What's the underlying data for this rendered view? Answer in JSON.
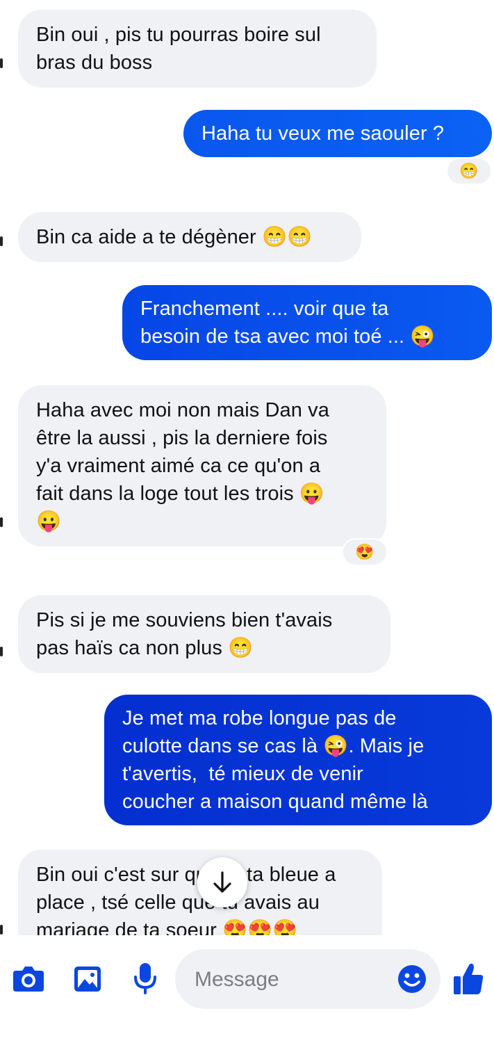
{
  "conversation": {
    "messages": [
      {
        "direction": "incoming",
        "text": "Bin oui , pis tu pourras boire sul\nbras du boss"
      },
      {
        "direction": "outgoing",
        "text": "Haha tu veux me saouler ?",
        "reaction": "😁"
      },
      {
        "direction": "incoming",
        "text": "Bin ca aide a te dégèner 😁😁"
      },
      {
        "direction": "outgoing",
        "text": "Franchement .... voir que ta\nbesoin de tsa avec moi toé ... 😜"
      },
      {
        "direction": "incoming",
        "text": "Haha avec moi non mais Dan va\nêtre la aussi , pis la derniere fois\ny'a vraiment aimé ca ce qu'on a\nfait dans la loge tout les trois 😛\n😛",
        "reaction": "😍"
      },
      {
        "direction": "incoming",
        "text": "Pis si je me souviens bien t'avais\npas haïs ca non plus 😁"
      },
      {
        "direction": "outgoing",
        "text": "Je met ma robe longue pas de\nculotte dans se cas là 😜. Mais je\nt'avertis,  té mieux de venir\ncoucher a maison quand même là"
      },
      {
        "direction": "incoming",
        "text": "Bin oui c'est sur que et ta bleue a\nplace , tsé celle que tu avais au\nmariage de ta soeur 😍😍😍"
      }
    ]
  },
  "composer": {
    "placeholder": "Message",
    "icons": [
      "camera-icon",
      "gallery-icon",
      "microphone-icon",
      "emoji-icon",
      "thumbs-up-icon"
    ]
  },
  "colors": {
    "accent": "#0a5af0",
    "incoming_bubble": "#f0f1f5",
    "outgoing_bubble_start": "#0b62f4",
    "outgoing_bubble_end": "#052fd0"
  }
}
